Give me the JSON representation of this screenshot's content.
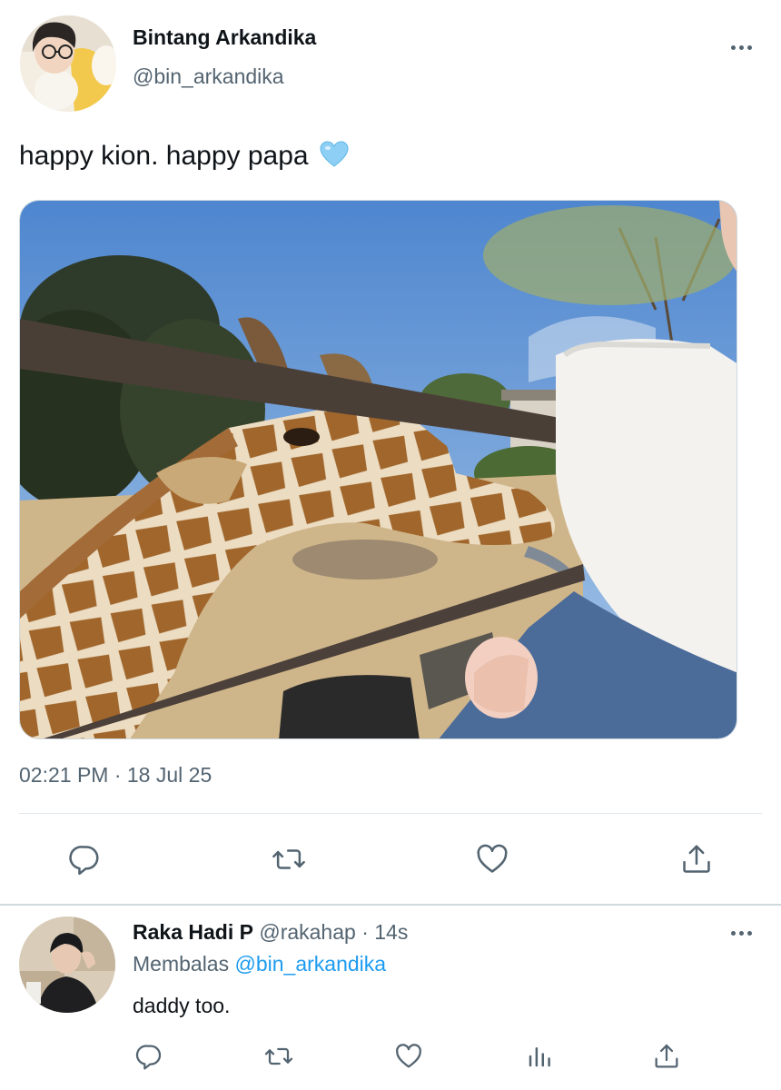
{
  "tweet": {
    "author_name": "Bintang Arkandika",
    "author_handle": "@bin_arkandika",
    "text": "happy kion. happy papa",
    "emoji": "light-blue-heart",
    "timestamp": "02:21 PM · 18 Jul 25",
    "photo_alt": "giraffe",
    "actions": [
      "reply-icon",
      "retweet-icon",
      "like-icon",
      "share-icon"
    ]
  },
  "reply": {
    "author_name": "Raka Hadi P",
    "author_handle": "@rakahap",
    "time": "· 14s",
    "replying_prefix": "Membalas",
    "replying_to": "@bin_arkandika",
    "text": "daddy too.",
    "actions": [
      "reply-icon",
      "retweet-icon",
      "like-icon",
      "analytics-icon",
      "share-icon"
    ]
  },
  "colors": {
    "link": "#1d9bf0",
    "secondary_text": "#536471",
    "primary_text": "#0f1419",
    "divider": "#e1e8ed"
  }
}
